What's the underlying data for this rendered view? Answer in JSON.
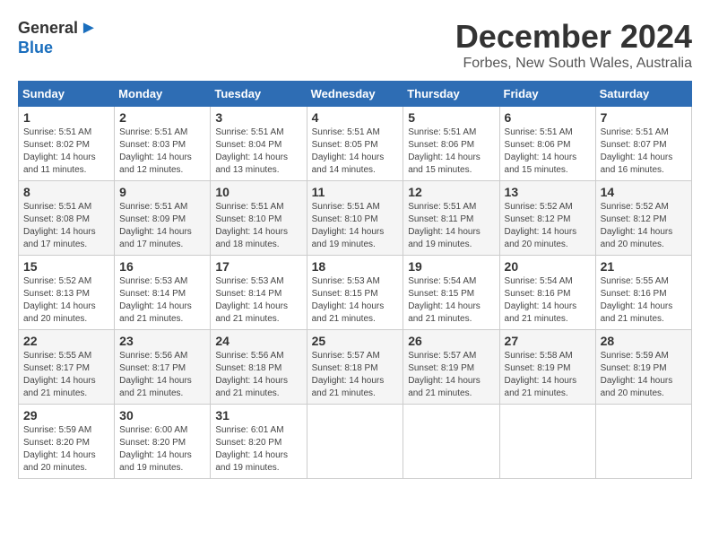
{
  "logo": {
    "general": "General",
    "blue": "Blue"
  },
  "title": "December 2024",
  "subtitle": "Forbes, New South Wales, Australia",
  "weekdays": [
    "Sunday",
    "Monday",
    "Tuesday",
    "Wednesday",
    "Thursday",
    "Friday",
    "Saturday"
  ],
  "weeks": [
    [
      {
        "day": "1",
        "info": "Sunrise: 5:51 AM\nSunset: 8:02 PM\nDaylight: 14 hours and 11 minutes."
      },
      {
        "day": "2",
        "info": "Sunrise: 5:51 AM\nSunset: 8:03 PM\nDaylight: 14 hours and 12 minutes."
      },
      {
        "day": "3",
        "info": "Sunrise: 5:51 AM\nSunset: 8:04 PM\nDaylight: 14 hours and 13 minutes."
      },
      {
        "day": "4",
        "info": "Sunrise: 5:51 AM\nSunset: 8:05 PM\nDaylight: 14 hours and 14 minutes."
      },
      {
        "day": "5",
        "info": "Sunrise: 5:51 AM\nSunset: 8:06 PM\nDaylight: 14 hours and 15 minutes."
      },
      {
        "day": "6",
        "info": "Sunrise: 5:51 AM\nSunset: 8:06 PM\nDaylight: 14 hours and 15 minutes."
      },
      {
        "day": "7",
        "info": "Sunrise: 5:51 AM\nSunset: 8:07 PM\nDaylight: 14 hours and 16 minutes."
      }
    ],
    [
      {
        "day": "8",
        "info": "Sunrise: 5:51 AM\nSunset: 8:08 PM\nDaylight: 14 hours and 17 minutes."
      },
      {
        "day": "9",
        "info": "Sunrise: 5:51 AM\nSunset: 8:09 PM\nDaylight: 14 hours and 17 minutes."
      },
      {
        "day": "10",
        "info": "Sunrise: 5:51 AM\nSunset: 8:10 PM\nDaylight: 14 hours and 18 minutes."
      },
      {
        "day": "11",
        "info": "Sunrise: 5:51 AM\nSunset: 8:10 PM\nDaylight: 14 hours and 19 minutes."
      },
      {
        "day": "12",
        "info": "Sunrise: 5:51 AM\nSunset: 8:11 PM\nDaylight: 14 hours and 19 minutes."
      },
      {
        "day": "13",
        "info": "Sunrise: 5:52 AM\nSunset: 8:12 PM\nDaylight: 14 hours and 20 minutes."
      },
      {
        "day": "14",
        "info": "Sunrise: 5:52 AM\nSunset: 8:12 PM\nDaylight: 14 hours and 20 minutes."
      }
    ],
    [
      {
        "day": "15",
        "info": "Sunrise: 5:52 AM\nSunset: 8:13 PM\nDaylight: 14 hours and 20 minutes."
      },
      {
        "day": "16",
        "info": "Sunrise: 5:53 AM\nSunset: 8:14 PM\nDaylight: 14 hours and 21 minutes."
      },
      {
        "day": "17",
        "info": "Sunrise: 5:53 AM\nSunset: 8:14 PM\nDaylight: 14 hours and 21 minutes."
      },
      {
        "day": "18",
        "info": "Sunrise: 5:53 AM\nSunset: 8:15 PM\nDaylight: 14 hours and 21 minutes."
      },
      {
        "day": "19",
        "info": "Sunrise: 5:54 AM\nSunset: 8:15 PM\nDaylight: 14 hours and 21 minutes."
      },
      {
        "day": "20",
        "info": "Sunrise: 5:54 AM\nSunset: 8:16 PM\nDaylight: 14 hours and 21 minutes."
      },
      {
        "day": "21",
        "info": "Sunrise: 5:55 AM\nSunset: 8:16 PM\nDaylight: 14 hours and 21 minutes."
      }
    ],
    [
      {
        "day": "22",
        "info": "Sunrise: 5:55 AM\nSunset: 8:17 PM\nDaylight: 14 hours and 21 minutes."
      },
      {
        "day": "23",
        "info": "Sunrise: 5:56 AM\nSunset: 8:17 PM\nDaylight: 14 hours and 21 minutes."
      },
      {
        "day": "24",
        "info": "Sunrise: 5:56 AM\nSunset: 8:18 PM\nDaylight: 14 hours and 21 minutes."
      },
      {
        "day": "25",
        "info": "Sunrise: 5:57 AM\nSunset: 8:18 PM\nDaylight: 14 hours and 21 minutes."
      },
      {
        "day": "26",
        "info": "Sunrise: 5:57 AM\nSunset: 8:19 PM\nDaylight: 14 hours and 21 minutes."
      },
      {
        "day": "27",
        "info": "Sunrise: 5:58 AM\nSunset: 8:19 PM\nDaylight: 14 hours and 21 minutes."
      },
      {
        "day": "28",
        "info": "Sunrise: 5:59 AM\nSunset: 8:19 PM\nDaylight: 14 hours and 20 minutes."
      }
    ],
    [
      {
        "day": "29",
        "info": "Sunrise: 5:59 AM\nSunset: 8:20 PM\nDaylight: 14 hours and 20 minutes."
      },
      {
        "day": "30",
        "info": "Sunrise: 6:00 AM\nSunset: 8:20 PM\nDaylight: 14 hours and 19 minutes."
      },
      {
        "day": "31",
        "info": "Sunrise: 6:01 AM\nSunset: 8:20 PM\nDaylight: 14 hours and 19 minutes."
      },
      null,
      null,
      null,
      null
    ]
  ]
}
